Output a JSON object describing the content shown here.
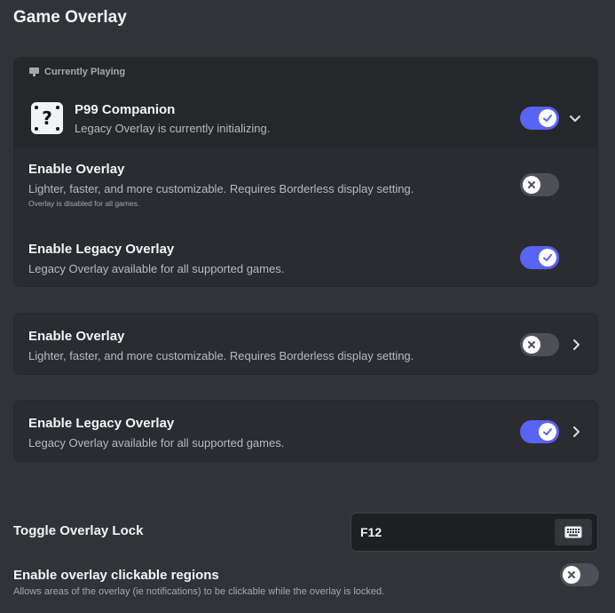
{
  "page": {
    "title": "Game Overlay"
  },
  "currently_playing": {
    "label": "Currently Playing",
    "game": {
      "name": "P99 Companion",
      "status": "Legacy Overlay is currently initializing.",
      "toggle_on": true
    },
    "settings": [
      {
        "title": "Enable Overlay",
        "description": "Lighter, faster, and more customizable. Requires Borderless display setting.",
        "note": "Overlay is disabled for all games.",
        "toggle_on": false
      },
      {
        "title": "Enable Legacy Overlay",
        "description": "Legacy Overlay available for all supported games.",
        "toggle_on": true
      }
    ]
  },
  "global_settings": [
    {
      "title": "Enable Overlay",
      "description": "Lighter, faster, and more customizable. Requires Borderless display setting.",
      "toggle_on": false
    },
    {
      "title": "Enable Legacy Overlay",
      "description": "Legacy Overlay available for all supported games.",
      "toggle_on": true
    }
  ],
  "overlay_lock": {
    "label": "Toggle Overlay Lock",
    "keybind": "F12"
  },
  "clickable_regions": {
    "title": "Enable overlay clickable regions",
    "description": "Allows areas of the overlay (ie notifications) to be clickable while the overlay is locked.",
    "toggle_on": false
  },
  "colors": {
    "accent": "#5865f2",
    "toggle_off": "#4e5058",
    "background": "#323339",
    "card": "#2b2c31"
  }
}
